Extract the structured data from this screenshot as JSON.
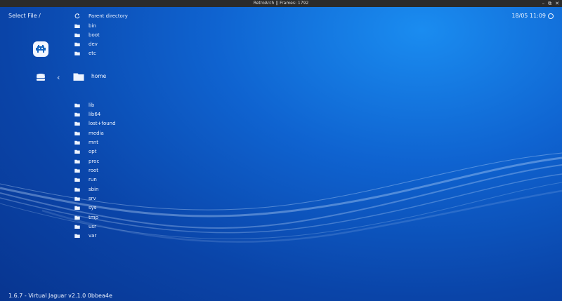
{
  "window": {
    "title": "RetroArch   || Frames: 1792",
    "controls": [
      "–",
      "⧉",
      "✕"
    ]
  },
  "header": {
    "left": "Select File /",
    "clock": "18/05 11:09"
  },
  "footer": {
    "version": "1.6.7 - Virtual Jaguar v2.1.0 0bbea4e"
  },
  "icons": {
    "logo": "retroarch-invader-logo",
    "storage": "database-icon",
    "back": "chevron-left-icon",
    "folder": "folder-icon",
    "parent": "refresh-icon"
  },
  "list": {
    "parent": "Parent directory",
    "above": [
      "bin",
      "boot",
      "dev",
      "etc"
    ],
    "selected": "home",
    "below": [
      "lib",
      "lib64",
      "lost+found",
      "media",
      "mnt",
      "opt",
      "proc",
      "root",
      "run",
      "sbin",
      "srv",
      "sys",
      "tmp",
      "usr",
      "var"
    ]
  },
  "colors": {
    "background_top": "#1a8cf0",
    "background_bottom": "#083590",
    "text": "#eef4ff",
    "titlebar": "#2b2b2b"
  }
}
